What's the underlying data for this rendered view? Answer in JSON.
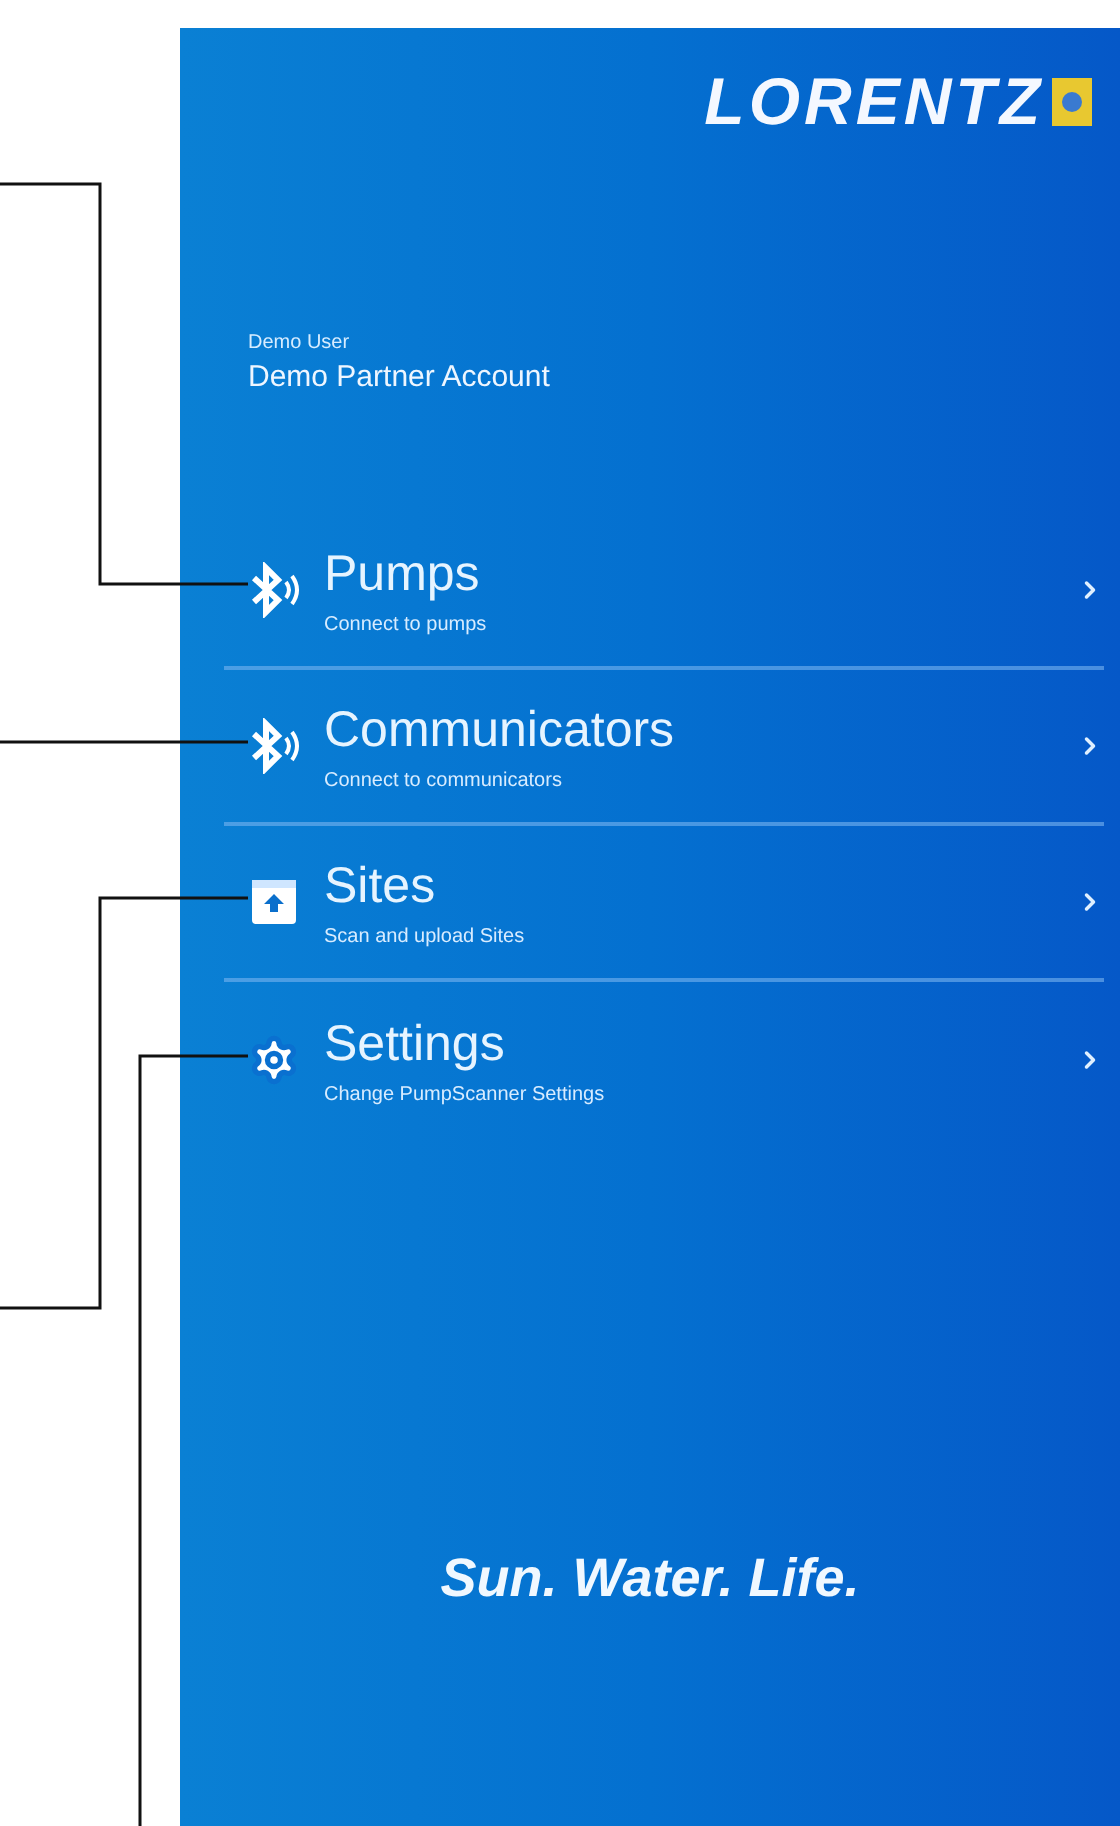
{
  "header": {
    "logo": "LORENTZ",
    "user_name": "Demo User",
    "account": "Demo Partner Account"
  },
  "menu": [
    {
      "title": "Pumps",
      "subtitle": "Connect to pumps",
      "kind": "bluetooth"
    },
    {
      "title": "Communicators",
      "subtitle": "Connect to communicators",
      "kind": "bluetooth"
    },
    {
      "title": "Sites",
      "subtitle": "Scan and upload Sites",
      "kind": "upload"
    },
    {
      "title": "Settings",
      "subtitle": "Change PumpScanner Settings",
      "kind": "settings"
    }
  ],
  "tagline": "Sun. Water. Life."
}
